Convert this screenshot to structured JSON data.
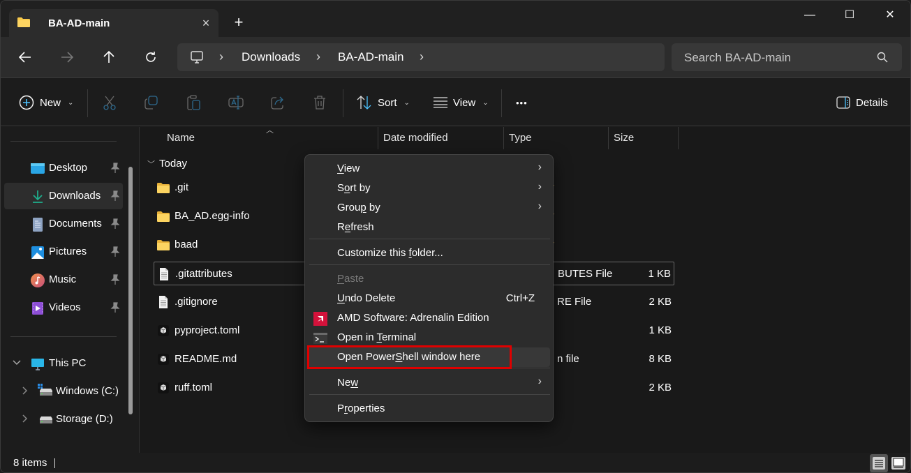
{
  "window": {
    "tab_title": "BA-AD-main",
    "tab_close_label": "×",
    "new_tab_label": "+",
    "controls": {
      "minimize": "—",
      "maximize": "☐",
      "close": "✕"
    }
  },
  "navbar": {
    "breadcrumb": [
      "Downloads",
      "BA-AD-main"
    ],
    "crumb_separator": "›",
    "search_placeholder": "Search BA-AD-main"
  },
  "toolbar": {
    "new_label": "New",
    "sort_label": "Sort",
    "view_label": "View",
    "more_label": "•••",
    "details_label": "Details",
    "dropdown_glyph": "⌄"
  },
  "sidebar": {
    "quick_access": [
      {
        "label": "Desktop",
        "icon": "desktop-icon",
        "pinned": true
      },
      {
        "label": "Downloads",
        "icon": "downloads-icon",
        "pinned": true,
        "selected": true
      },
      {
        "label": "Documents",
        "icon": "documents-icon",
        "pinned": true
      },
      {
        "label": "Pictures",
        "icon": "pictures-icon",
        "pinned": true
      },
      {
        "label": "Music",
        "icon": "music-icon",
        "pinned": true
      },
      {
        "label": "Videos",
        "icon": "videos-icon",
        "pinned": true
      }
    ],
    "this_pc": {
      "label": "This PC",
      "expanded": true
    },
    "drives": [
      {
        "label": "Windows (C:)"
      },
      {
        "label": "Storage (D:)"
      }
    ]
  },
  "file_list": {
    "columns": [
      "Name",
      "Date modified",
      "Type",
      "Size"
    ],
    "group_label": "Today",
    "files": [
      {
        "name": ".git",
        "kind": "folder",
        "type": "r",
        "size": ""
      },
      {
        "name": "BA_AD.egg-info",
        "kind": "folder",
        "type": "r",
        "size": ""
      },
      {
        "name": "baad",
        "kind": "folder",
        "type": "r",
        "size": ""
      },
      {
        "name": ".gitattributes",
        "kind": "text",
        "type": "BUTES File",
        "size": "1 KB",
        "focused": true
      },
      {
        "name": ".gitignore",
        "kind": "text",
        "type": "RE File",
        "size": "2 KB"
      },
      {
        "name": "pyproject.toml",
        "kind": "app",
        "type": "",
        "size": "1 KB"
      },
      {
        "name": "README.md",
        "kind": "app",
        "type": "n file",
        "size": "8 KB"
      },
      {
        "name": "ruff.toml",
        "kind": "app",
        "type": "",
        "size": "2 KB"
      }
    ]
  },
  "status": {
    "item_count": "8 items"
  },
  "context_menu": {
    "items": [
      {
        "pre": "",
        "u": "V",
        "post": "iew",
        "submenu": true
      },
      {
        "pre": "S",
        "u": "o",
        "post": "rt by",
        "submenu": true
      },
      {
        "pre": "Grou",
        "u": "p",
        "post": " by",
        "submenu": true
      },
      {
        "pre": "R",
        "u": "e",
        "post": "fresh"
      },
      {
        "pre": "Customize this ",
        "u": "f",
        "post": "older..."
      },
      {
        "pre": "",
        "u": "P",
        "post": "aste",
        "disabled": true
      },
      {
        "pre": "",
        "u": "U",
        "post": "ndo Delete",
        "shortcut": "Ctrl+Z"
      },
      {
        "pre": "AMD Software: Adrenalin Edition",
        "u": "",
        "post": "",
        "icon": "amd-icon"
      },
      {
        "pre": "Open in ",
        "u": "T",
        "post": "erminal",
        "icon": "terminal-icon"
      },
      {
        "pre": "Open Power",
        "u": "S",
        "post": "hell window here",
        "hover": true
      },
      {
        "pre": "Ne",
        "u": "w",
        "post": "",
        "submenu": true
      },
      {
        "pre": "P",
        "u": "r",
        "post": "operties"
      }
    ],
    "submenu_glyph": "›"
  },
  "colors": {
    "accent": "#4cc2ff",
    "highlight_box": "#e00000",
    "folder": "#f8c94b",
    "amd_red": "#d4123b"
  }
}
